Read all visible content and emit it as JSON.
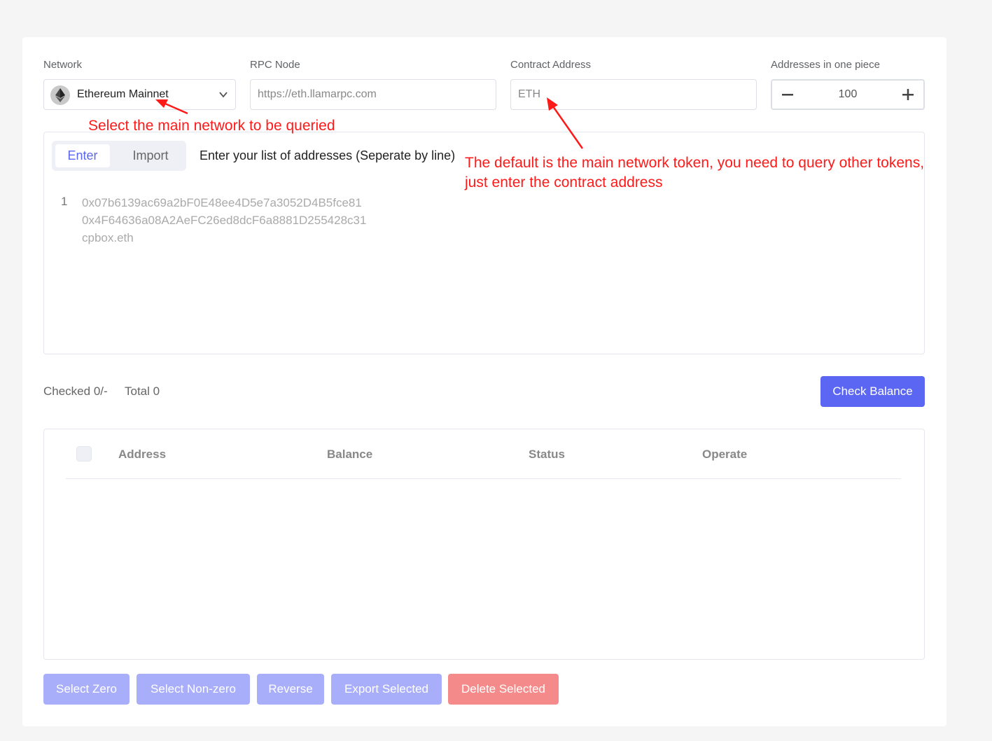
{
  "form": {
    "network_label": "Network",
    "network_value": "Ethereum Mainnet",
    "rpc_label": "RPC Node",
    "rpc_placeholder": "https://eth.llamarpc.com",
    "contract_label": "Contract Address",
    "contract_placeholder": "ETH",
    "pieces_label": "Addresses in one piece",
    "pieces_value": "100"
  },
  "editor": {
    "tabs": [
      {
        "label": "Enter",
        "active": true
      },
      {
        "label": "Import",
        "active": false
      }
    ],
    "hint": "Enter your list of addresses (Seperate by line)",
    "line_number": "1",
    "placeholder_lines": [
      "0x07b6139ac69a2bF0E48ee4D5e7a3052D4B5fce81",
      "0x4F64636a08A2AeFC26ed8dcF6a8881D255428c31",
      "cpbox.eth"
    ]
  },
  "stats": {
    "checked": "Checked 0/-",
    "total": "Total 0"
  },
  "check_balance_label": "Check Balance",
  "table": {
    "headers": [
      "Address",
      "Balance",
      "Status",
      "Operate"
    ]
  },
  "bottom_buttons": [
    "Select Zero",
    "Select Non-zero",
    "Reverse",
    "Export Selected",
    "Delete Selected"
  ],
  "annotations": {
    "network_note": "Select the main network to be queried",
    "contract_note_line1": "The default is the main network token, you need to query other tokens,",
    "contract_note_line2": "just enter the contract address",
    "color": "#ff1a1a"
  },
  "colors": {
    "primary": "#5b66f2",
    "primary_light": "#a9aefb",
    "danger_light": "#f58a8a",
    "background": "#f5f5f5"
  }
}
